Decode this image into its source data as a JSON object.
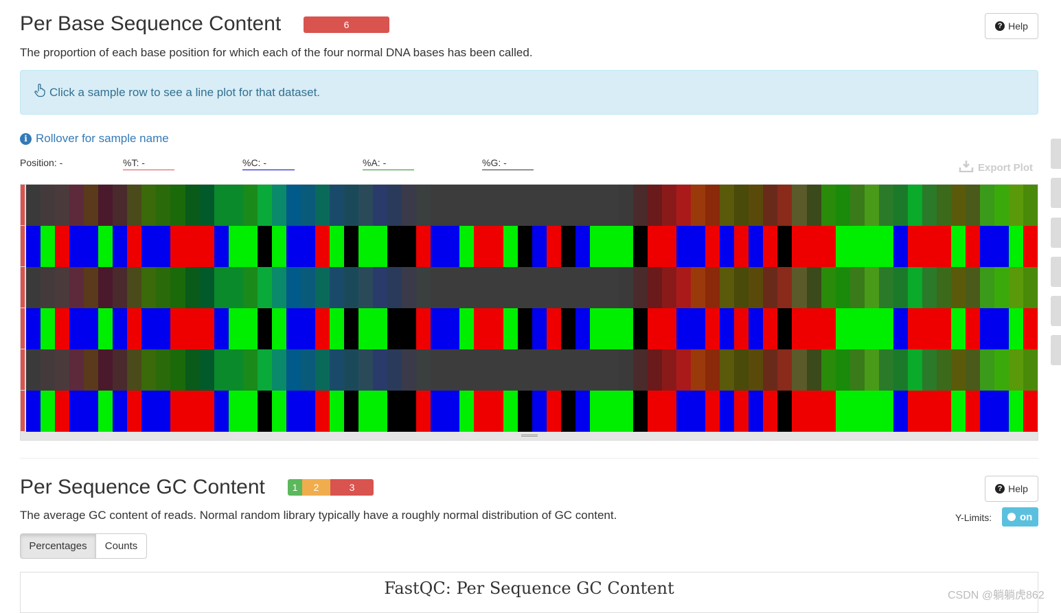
{
  "section1": {
    "title": "Per Base Sequence Content",
    "badge_count": "6",
    "badge_color": "#d9534f",
    "help_label": "Help",
    "description": "The proportion of each base position for which each of the four normal DNA bases has been called.",
    "info_text": "Click a sample row to see a line plot for that dataset.",
    "rollover_text": "Rollover for sample name",
    "readouts": {
      "position": "Position: -",
      "t": "%T: -",
      "c": "%C: -",
      "a": "%A: -",
      "g": "%G: -"
    },
    "readout_colors": {
      "t": "#d9534f",
      "c": "#0000cc",
      "a": "#2e8b2e",
      "g": "#333333"
    },
    "export_label": "Export Plot",
    "heatmap": {
      "dark_row_colors": [
        "#3a3a3a",
        "#443a3c",
        "#4a3a3c",
        "#5c2a3a",
        "#5a3a1a",
        "#4a1a2c",
        "#4a2a2c",
        "#4a4a1a",
        "#3a6a0a",
        "#2a6a0a",
        "#1a6a0a",
        "#0a5a1a",
        "#005a2a",
        "#0a8a2a",
        "#0a8a2a",
        "#1a8a1a",
        "#0aaa3a",
        "#0a8a6a",
        "#005a8a",
        "#0a5a7a",
        "#0a6a5a",
        "#1a4a6a",
        "#1a4a5a",
        "#2a4a5a",
        "#2a3a6a",
        "#2a3a5a",
        "#3a3a4a",
        "#3a3f40",
        "#3c3c3c",
        "#3c3c3c",
        "#3c3c3c",
        "#3c3c3c",
        "#3c3c3c",
        "#3c3c3c",
        "#3c3c3c",
        "#3c3c3c",
        "#3c3c3c",
        "#3c3c3c",
        "#3c3c3c",
        "#3c3c3c",
        "#3c3c3c",
        "#3a3a3a",
        "#4a2a2a",
        "#6a1a1a",
        "#8a1a1a",
        "#aa1a1a",
        "#9a3a0a",
        "#8a2a0a",
        "#5a5a0a",
        "#4a4a0a",
        "#5a4a0a",
        "#6a2a1a",
        "#8a2a1a",
        "#5a5a2a",
        "#3a4a1a",
        "#2a8a0a",
        "#1a8a0a",
        "#3a7a1a",
        "#4a9a1a",
        "#2a7a2a",
        "#1a7a2a",
        "#0aaa2a",
        "#2a7a2a",
        "#3a6a1a",
        "#5a5a0a",
        "#4a5a1a",
        "#3a9a1a",
        "#3aaa0a",
        "#5a9a0a",
        "#4a8a0a"
      ],
      "bright_row_colors": [
        "#0000ee",
        "#00ee00",
        "#ee0000",
        "#0000ee",
        "#0000ee",
        "#00ee00",
        "#0000ee",
        "#ee0000",
        "#0000ee",
        "#0000ee",
        "#ee0000",
        "#ee0000",
        "#ee0000",
        "#0000ee",
        "#00ee00",
        "#00ee00",
        "#000000",
        "#00ee00",
        "#0000ee",
        "#0000ee",
        "#ee0000",
        "#00ee00",
        "#000000",
        "#00ee00",
        "#00ee00",
        "#000000",
        "#000000",
        "#ee0000",
        "#0000ee",
        "#0000ee",
        "#00ee00",
        "#ee0000",
        "#ee0000",
        "#00ee00",
        "#000000",
        "#0000ee",
        "#ee0000",
        "#000000",
        "#0000ee",
        "#00ee00",
        "#00ee00",
        "#00ee00",
        "#000000",
        "#ee0000",
        "#ee0000",
        "#0000ee",
        "#0000ee",
        "#ee0000",
        "#0000ee",
        "#ee0000",
        "#0000ee",
        "#ee0000",
        "#000000",
        "#ee0000",
        "#ee0000",
        "#ee0000",
        "#00ee00",
        "#00ee00",
        "#00ee00",
        "#00ee00",
        "#0000ee",
        "#ee0000",
        "#ee0000",
        "#ee0000",
        "#00ee00",
        "#ee0000",
        "#0000ee",
        "#0000ee",
        "#00ee00",
        "#ee0000"
      ]
    }
  },
  "section2": {
    "title": "Per Sequence GC Content",
    "badges": [
      {
        "label": "1",
        "color": "#5cb85c"
      },
      {
        "label": "2",
        "color": "#f0ad4e"
      },
      {
        "label": "3",
        "color": "#d9534f"
      }
    ],
    "help_label": "Help",
    "description": "The average GC content of reads. Normal random library typically have a roughly normal distribution of GC content.",
    "ylimits_label": "Y-Limits:",
    "toggle_label": "on",
    "tabs": [
      "Percentages",
      "Counts"
    ],
    "active_tab": "Percentages",
    "plot_title": "FastQC: Per Sequence GC Content"
  },
  "watermark": "CSDN @躺躺虎862"
}
